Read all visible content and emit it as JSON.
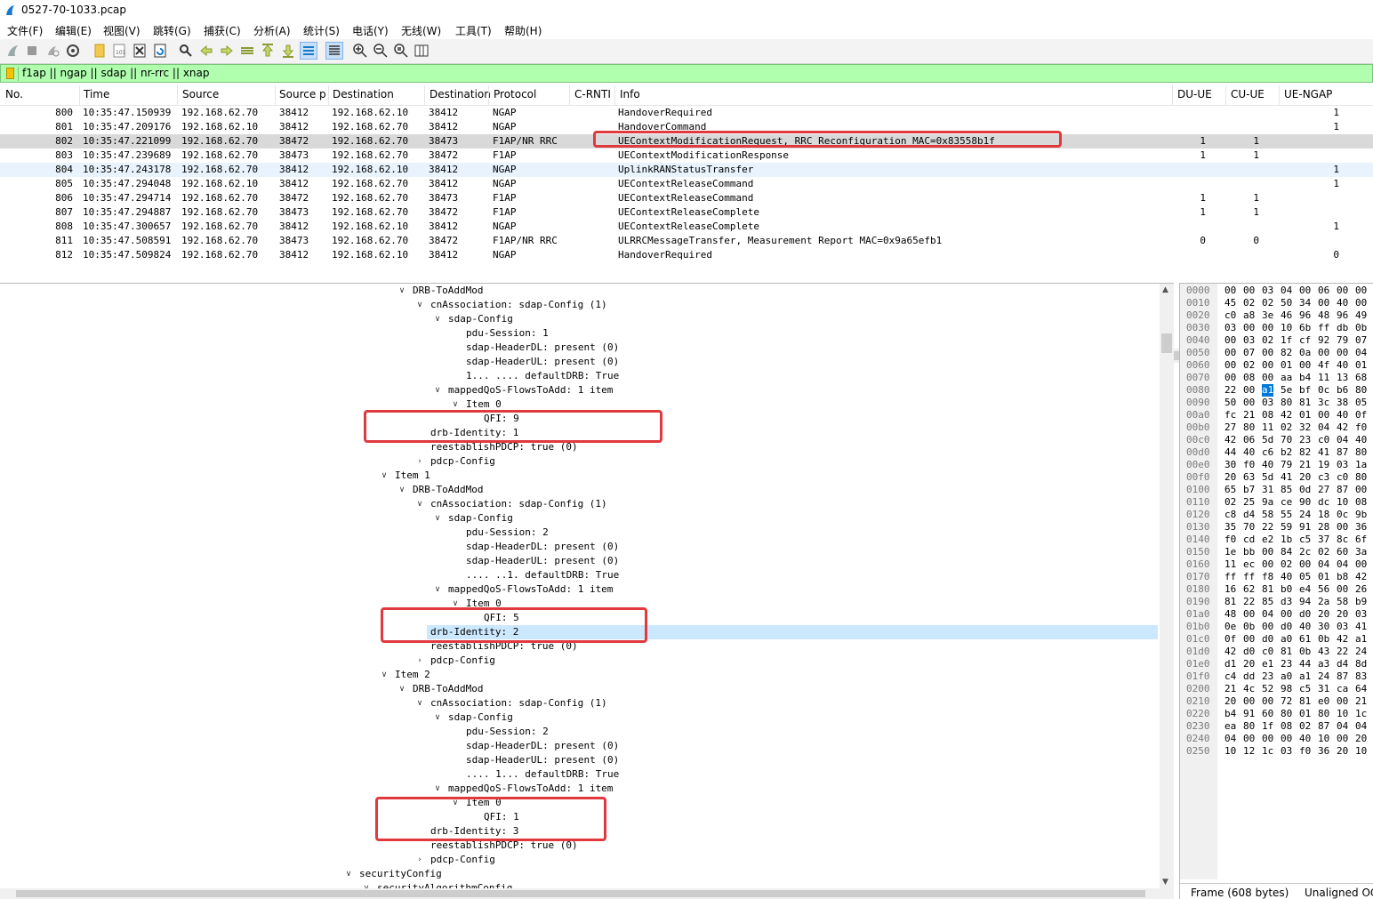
{
  "window": {
    "title": "0527-70-1033.pcap"
  },
  "menu": [
    "文件(F)",
    "编辑(E)",
    "视图(V)",
    "跳转(G)",
    "捕获(C)",
    "分析(A)",
    "统计(S)",
    "电话(Y)",
    "无线(W)",
    "工具(T)",
    "帮助(H)"
  ],
  "filter": {
    "expression": "f1ap || ngap || sdap || nr-rrc || xnap"
  },
  "packet_list": {
    "columns": [
      "No.",
      "Time",
      "Source",
      "Source p",
      "Destination",
      "Destination",
      "Protocol",
      "C-RNTI",
      "Info",
      "DU-UE",
      "CU-UE",
      "UE-NGAP"
    ],
    "rows": [
      {
        "no": "800",
        "time": "10:35:47.150939",
        "src": "192.168.62.70",
        "sport": "38412",
        "dst": "192.168.62.10",
        "dport": "38412",
        "proto": "NGAP",
        "info": "HandoverRequired",
        "du": "",
        "cu": "",
        "ngap": "1"
      },
      {
        "no": "801",
        "time": "10:35:47.209176",
        "src": "192.168.62.10",
        "sport": "38412",
        "dst": "192.168.62.70",
        "dport": "38412",
        "proto": "NGAP",
        "info": "HandoverCommand",
        "du": "",
        "cu": "",
        "ngap": "1"
      },
      {
        "no": "802",
        "time": "10:35:47.221099",
        "src": "192.168.62.70",
        "sport": "38472",
        "dst": "192.168.62.70",
        "dport": "38473",
        "proto": "F1AP/NR RRC",
        "info": "UEContextModificationRequest, RRC Reconfiguration MAC=0x83558b1f",
        "du": "1",
        "cu": "1",
        "ngap": ""
      },
      {
        "no": "803",
        "time": "10:35:47.239689",
        "src": "192.168.62.70",
        "sport": "38473",
        "dst": "192.168.62.70",
        "dport": "38472",
        "proto": "F1AP",
        "info": "UEContextModificationResponse",
        "du": "1",
        "cu": "1",
        "ngap": ""
      },
      {
        "no": "804",
        "time": "10:35:47.243178",
        "src": "192.168.62.70",
        "sport": "38412",
        "dst": "192.168.62.10",
        "dport": "38412",
        "proto": "NGAP",
        "info": "UplinkRANStatusTransfer",
        "du": "",
        "cu": "",
        "ngap": "1"
      },
      {
        "no": "805",
        "time": "10:35:47.294048",
        "src": "192.168.62.10",
        "sport": "38412",
        "dst": "192.168.62.70",
        "dport": "38412",
        "proto": "NGAP",
        "info": "UEContextReleaseCommand",
        "du": "",
        "cu": "",
        "ngap": "1"
      },
      {
        "no": "806",
        "time": "10:35:47.294714",
        "src": "192.168.62.70",
        "sport": "38472",
        "dst": "192.168.62.70",
        "dport": "38473",
        "proto": "F1AP",
        "info": "UEContextReleaseCommand",
        "du": "1",
        "cu": "1",
        "ngap": ""
      },
      {
        "no": "807",
        "time": "10:35:47.294887",
        "src": "192.168.62.70",
        "sport": "38473",
        "dst": "192.168.62.70",
        "dport": "38472",
        "proto": "F1AP",
        "info": "UEContextReleaseComplete",
        "du": "1",
        "cu": "1",
        "ngap": ""
      },
      {
        "no": "808",
        "time": "10:35:47.300657",
        "src": "192.168.62.70",
        "sport": "38412",
        "dst": "192.168.62.10",
        "dport": "38412",
        "proto": "NGAP",
        "info": "UEContextReleaseComplete",
        "du": "",
        "cu": "",
        "ngap": "1"
      },
      {
        "no": "811",
        "time": "10:35:47.508591",
        "src": "192.168.62.70",
        "sport": "38473",
        "dst": "192.168.62.70",
        "dport": "38472",
        "proto": "F1AP/NR RRC",
        "info": "ULRRCMessageTransfer, Measurement Report MAC=0x9a65efb1",
        "du": "0",
        "cu": "0",
        "ngap": ""
      },
      {
        "no": "812",
        "time": "10:35:47.509824",
        "src": "192.168.62.70",
        "sport": "38412",
        "dst": "192.168.62.10",
        "dport": "38412",
        "proto": "NGAP",
        "info": "HandoverRequired",
        "du": "",
        "cu": "",
        "ngap": "0"
      }
    ]
  },
  "details": {
    "lines": [
      {
        "text": "DRB-ToAddMod",
        "level": 6,
        "state": "open"
      },
      {
        "text": "cnAssociation: sdap-Config (1)",
        "level": 7,
        "state": "open"
      },
      {
        "text": "sdap-Config",
        "level": 8,
        "state": "open"
      },
      {
        "text": "pdu-Session: 1",
        "level": 9,
        "state": "leaf"
      },
      {
        "text": "sdap-HeaderDL: present (0)",
        "level": 9,
        "state": "leaf"
      },
      {
        "text": "sdap-HeaderUL: present (0)",
        "level": 9,
        "state": "leaf"
      },
      {
        "text": "1... .... defaultDRB: True",
        "level": 9,
        "state": "leaf"
      },
      {
        "text": "mappedQoS-FlowsToAdd: 1 item",
        "level": 8,
        "state": "open"
      },
      {
        "text": "Item 0",
        "level": 9,
        "state": "open"
      },
      {
        "text": "QFI: 9",
        "level": 10,
        "state": "leaf"
      },
      {
        "text": "drb-Identity: 1",
        "level": 7,
        "state": "leaf"
      },
      {
        "text": "reestablishPDCP: true (0)",
        "level": 7,
        "state": "leaf"
      },
      {
        "text": "pdcp-Config",
        "level": 7,
        "state": "closed"
      },
      {
        "text": "Item 1",
        "level": 5,
        "state": "open"
      },
      {
        "text": "DRB-ToAddMod",
        "level": 6,
        "state": "open"
      },
      {
        "text": "cnAssociation: sdap-Config (1)",
        "level": 7,
        "state": "open"
      },
      {
        "text": "sdap-Config",
        "level": 8,
        "state": "open"
      },
      {
        "text": "pdu-Session: 2",
        "level": 9,
        "state": "leaf"
      },
      {
        "text": "sdap-HeaderDL: present (0)",
        "level": 9,
        "state": "leaf"
      },
      {
        "text": "sdap-HeaderUL: present (0)",
        "level": 9,
        "state": "leaf"
      },
      {
        "text": ".... ..1. defaultDRB: True",
        "level": 9,
        "state": "leaf"
      },
      {
        "text": "mappedQoS-FlowsToAdd: 1 item",
        "level": 8,
        "state": "open"
      },
      {
        "text": "Item 0",
        "level": 9,
        "state": "open"
      },
      {
        "text": "QFI: 5",
        "level": 10,
        "state": "leaf"
      },
      {
        "text": "drb-Identity: 2",
        "level": 7,
        "state": "leaf",
        "selected": true
      },
      {
        "text": "reestablishPDCP: true (0)",
        "level": 7,
        "state": "leaf"
      },
      {
        "text": "pdcp-Config",
        "level": 7,
        "state": "closed"
      },
      {
        "text": "Item 2",
        "level": 5,
        "state": "open"
      },
      {
        "text": "DRB-ToAddMod",
        "level": 6,
        "state": "open"
      },
      {
        "text": "cnAssociation: sdap-Config (1)",
        "level": 7,
        "state": "open"
      },
      {
        "text": "sdap-Config",
        "level": 8,
        "state": "open"
      },
      {
        "text": "pdu-Session: 2",
        "level": 9,
        "state": "leaf"
      },
      {
        "text": "sdap-HeaderDL: present (0)",
        "level": 9,
        "state": "leaf"
      },
      {
        "text": "sdap-HeaderUL: present (0)",
        "level": 9,
        "state": "leaf"
      },
      {
        "text": ".... 1... defaultDRB: True",
        "level": 9,
        "state": "leaf"
      },
      {
        "text": "mappedQoS-FlowsToAdd: 1 item",
        "level": 8,
        "state": "open"
      },
      {
        "text": "Item 0",
        "level": 9,
        "state": "open"
      },
      {
        "text": "QFI: 1",
        "level": 10,
        "state": "leaf"
      },
      {
        "text": "drb-Identity: 3",
        "level": 7,
        "state": "leaf"
      },
      {
        "text": "reestablishPDCP: true (0)",
        "level": 7,
        "state": "leaf"
      },
      {
        "text": "pdcp-Config",
        "level": 7,
        "state": "closed"
      },
      {
        "text": "securityConfig",
        "level": 3,
        "state": "open"
      },
      {
        "text": "securityAlgorithmConfig",
        "level": 4,
        "state": "open"
      }
    ]
  },
  "bytes": {
    "lines": [
      {
        "off": "0000",
        "hex": [
          "00",
          "00",
          "03",
          "04",
          "00",
          "06",
          "00",
          "00"
        ]
      },
      {
        "off": "0010",
        "hex": [
          "45",
          "02",
          "02",
          "50",
          "34",
          "00",
          "40",
          "00"
        ]
      },
      {
        "off": "0020",
        "hex": [
          "c0",
          "a8",
          "3e",
          "46",
          "96",
          "48",
          "96",
          "49"
        ]
      },
      {
        "off": "0030",
        "hex": [
          "03",
          "00",
          "00",
          "10",
          "6b",
          "ff",
          "db",
          "0b"
        ]
      },
      {
        "off": "0040",
        "hex": [
          "00",
          "03",
          "02",
          "1f",
          "cf",
          "92",
          "79",
          "07"
        ]
      },
      {
        "off": "0050",
        "hex": [
          "00",
          "07",
          "00",
          "82",
          "0a",
          "00",
          "00",
          "04"
        ]
      },
      {
        "off": "0060",
        "hex": [
          "00",
          "02",
          "00",
          "01",
          "00",
          "4f",
          "40",
          "01"
        ]
      },
      {
        "off": "0070",
        "hex": [
          "00",
          "08",
          "00",
          "aa",
          "b4",
          "11",
          "13",
          "68"
        ]
      },
      {
        "off": "0080",
        "hex": [
          "22",
          "00",
          "a1",
          "5e",
          "bf",
          "0c",
          "b6",
          "80"
        ],
        "sel": 2
      },
      {
        "off": "0090",
        "hex": [
          "50",
          "00",
          "03",
          "80",
          "81",
          "3c",
          "38",
          "05"
        ]
      },
      {
        "off": "00a0",
        "hex": [
          "fc",
          "21",
          "08",
          "42",
          "01",
          "00",
          "40",
          "0f"
        ]
      },
      {
        "off": "00b0",
        "hex": [
          "27",
          "80",
          "11",
          "02",
          "32",
          "04",
          "42",
          "f0"
        ]
      },
      {
        "off": "00c0",
        "hex": [
          "42",
          "06",
          "5d",
          "70",
          "23",
          "c0",
          "04",
          "40"
        ]
      },
      {
        "off": "00d0",
        "hex": [
          "44",
          "40",
          "c6",
          "b2",
          "82",
          "41",
          "87",
          "80"
        ]
      },
      {
        "off": "00e0",
        "hex": [
          "30",
          "f0",
          "40",
          "79",
          "21",
          "19",
          "03",
          "1a"
        ]
      },
      {
        "off": "00f0",
        "hex": [
          "20",
          "63",
          "5d",
          "41",
          "20",
          "c3",
          "c0",
          "80"
        ]
      },
      {
        "off": "0100",
        "hex": [
          "65",
          "b7",
          "31",
          "85",
          "0d",
          "27",
          "87",
          "00"
        ]
      },
      {
        "off": "0110",
        "hex": [
          "02",
          "25",
          "9a",
          "ce",
          "90",
          "dc",
          "10",
          "08"
        ]
      },
      {
        "off": "0120",
        "hex": [
          "c8",
          "d4",
          "58",
          "55",
          "24",
          "18",
          "0c",
          "9b"
        ]
      },
      {
        "off": "0130",
        "hex": [
          "35",
          "70",
          "22",
          "59",
          "91",
          "28",
          "00",
          "36"
        ]
      },
      {
        "off": "0140",
        "hex": [
          "f0",
          "cd",
          "e2",
          "1b",
          "c5",
          "37",
          "8c",
          "6f"
        ]
      },
      {
        "off": "0150",
        "hex": [
          "1e",
          "bb",
          "00",
          "84",
          "2c",
          "02",
          "60",
          "3a"
        ]
      },
      {
        "off": "0160",
        "hex": [
          "11",
          "ec",
          "00",
          "02",
          "00",
          "04",
          "04",
          "00"
        ]
      },
      {
        "off": "0170",
        "hex": [
          "ff",
          "ff",
          "f8",
          "40",
          "05",
          "01",
          "b8",
          "42"
        ]
      },
      {
        "off": "0180",
        "hex": [
          "16",
          "62",
          "81",
          "b0",
          "e4",
          "56",
          "00",
          "26"
        ]
      },
      {
        "off": "0190",
        "hex": [
          "81",
          "22",
          "85",
          "d3",
          "94",
          "2a",
          "58",
          "b9"
        ]
      },
      {
        "off": "01a0",
        "hex": [
          "48",
          "00",
          "04",
          "00",
          "d0",
          "20",
          "20",
          "03"
        ]
      },
      {
        "off": "01b0",
        "hex": [
          "0e",
          "0b",
          "00",
          "d0",
          "40",
          "30",
          "03",
          "41"
        ]
      },
      {
        "off": "01c0",
        "hex": [
          "0f",
          "00",
          "d0",
          "a0",
          "61",
          "0b",
          "42",
          "a1"
        ]
      },
      {
        "off": "01d0",
        "hex": [
          "42",
          "d0",
          "c0",
          "81",
          "0b",
          "43",
          "22",
          "24"
        ]
      },
      {
        "off": "01e0",
        "hex": [
          "d1",
          "20",
          "e1",
          "23",
          "44",
          "a3",
          "d4",
          "8d"
        ]
      },
      {
        "off": "01f0",
        "hex": [
          "c4",
          "dd",
          "23",
          "a0",
          "a1",
          "24",
          "87",
          "83"
        ]
      },
      {
        "off": "0200",
        "hex": [
          "21",
          "4c",
          "52",
          "98",
          "c5",
          "31",
          "ca",
          "64"
        ]
      },
      {
        "off": "0210",
        "hex": [
          "20",
          "00",
          "00",
          "72",
          "81",
          "e0",
          "00",
          "21"
        ]
      },
      {
        "off": "0220",
        "hex": [
          "b4",
          "91",
          "60",
          "80",
          "01",
          "80",
          "10",
          "1c"
        ]
      },
      {
        "off": "0230",
        "hex": [
          "ea",
          "80",
          "1f",
          "08",
          "02",
          "87",
          "04",
          "04"
        ]
      },
      {
        "off": "0240",
        "hex": [
          "04",
          "00",
          "00",
          "00",
          "40",
          "10",
          "00",
          "20"
        ]
      },
      {
        "off": "0250",
        "hex": [
          "10",
          "12",
          "1c",
          "03",
          "f0",
          "36",
          "20",
          "10"
        ]
      }
    ],
    "tabs": [
      "Frame (608 bytes)",
      "Unaligned OC"
    ]
  }
}
